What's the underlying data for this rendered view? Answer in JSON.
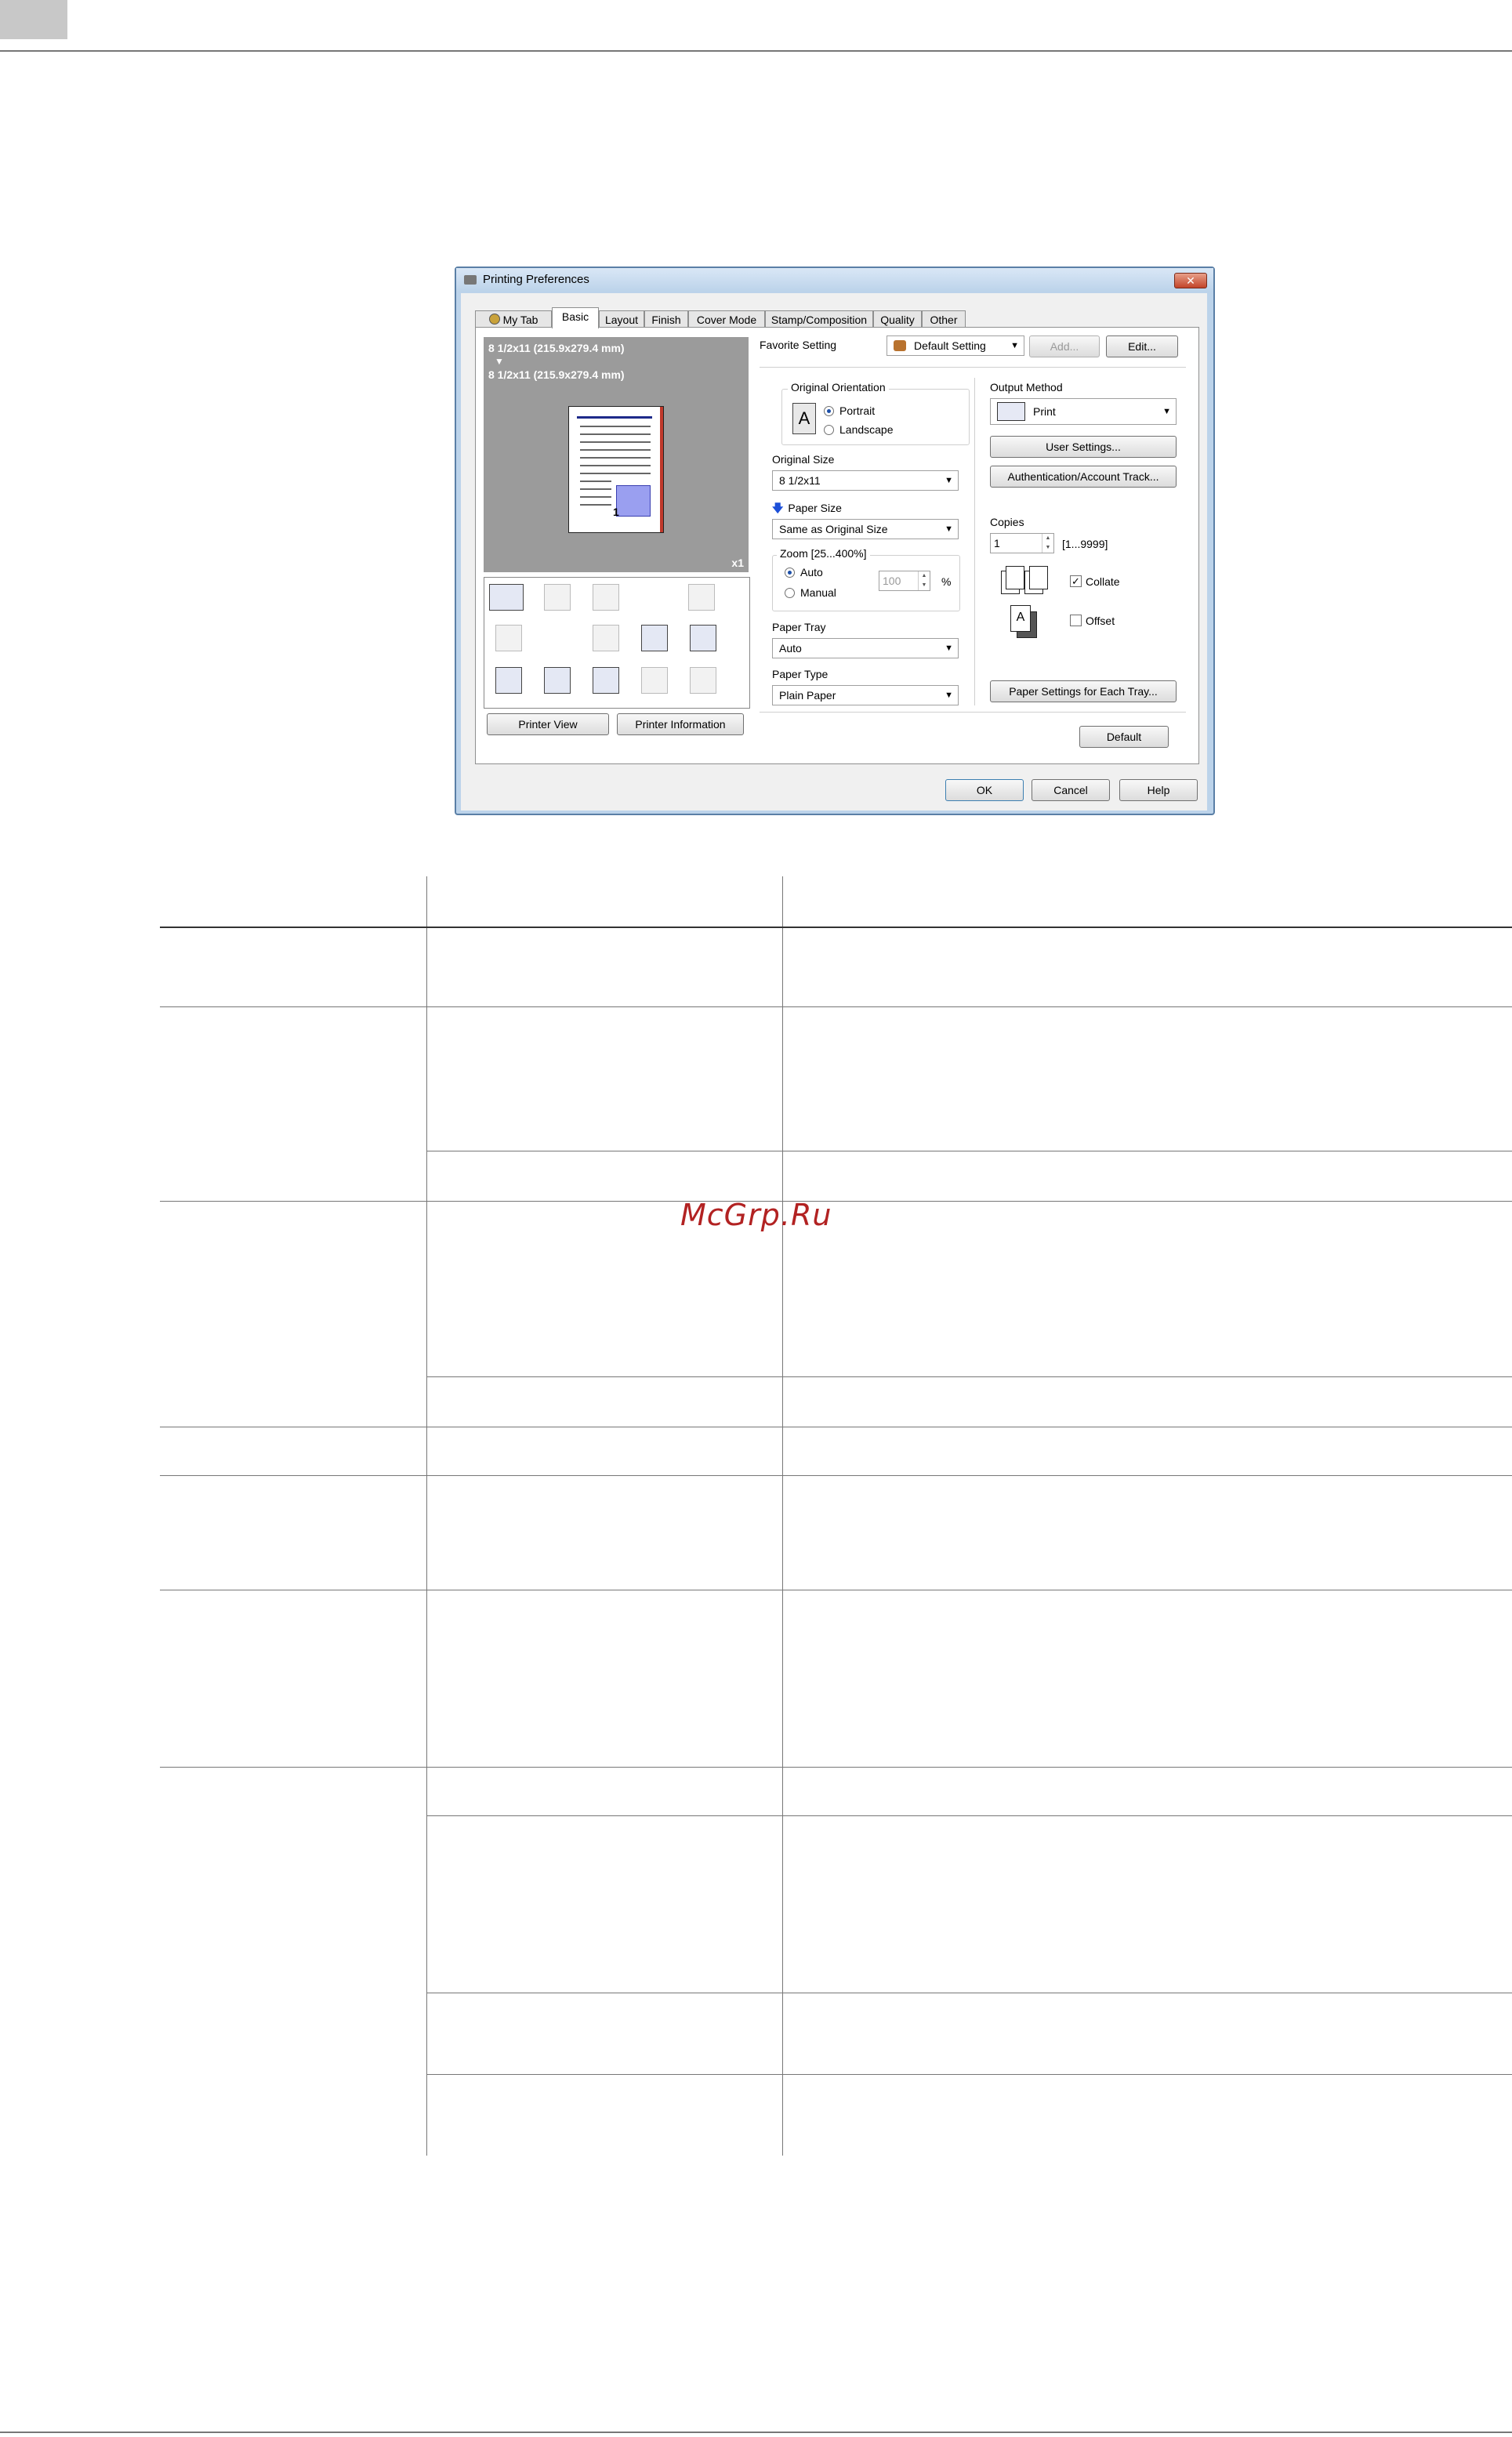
{
  "watermark": "McGrp.Ru",
  "dialog": {
    "title": "Printing Preferences",
    "close_symbol": "✕",
    "tabs": [
      "My Tab",
      "Basic",
      "Layout",
      "Finish",
      "Cover Mode",
      "Stamp/Composition",
      "Quality",
      "Other"
    ],
    "active_tab": "Basic",
    "preview": {
      "original_size_text": "8 1/2x11 (215.9x279.4 mm)",
      "arrow": "▼",
      "paper_size_text": "8 1/2x11 (215.9x279.4 mm)",
      "count": "x1",
      "page_number": "1"
    },
    "printer_view_button": "Printer View",
    "printer_information_button": "Printer Information",
    "favorite_setting": {
      "label": "Favorite Setting",
      "value": "Default Setting",
      "add_button": "Add...",
      "edit_button": "Edit..."
    },
    "original_orientation": {
      "label": "Original Orientation",
      "options": [
        "Portrait",
        "Landscape"
      ],
      "selected": "Portrait"
    },
    "original_size": {
      "label": "Original Size",
      "value": "8 1/2x11"
    },
    "paper_size": {
      "label": "Paper Size",
      "value": "Same as Original Size"
    },
    "zoom": {
      "label": "Zoom [25...400%]",
      "options": [
        "Auto",
        "Manual"
      ],
      "selected": "Auto",
      "value": "100",
      "unit": "%"
    },
    "paper_tray": {
      "label": "Paper Tray",
      "value": "Auto"
    },
    "paper_type": {
      "label": "Paper Type",
      "value": "Plain Paper"
    },
    "output_method": {
      "label": "Output Method",
      "value": "Print"
    },
    "user_settings_button": "User Settings...",
    "authentication_button": "Authentication/Account Track...",
    "copies": {
      "label": "Copies",
      "value": "1",
      "range": "[1...9999]"
    },
    "collate": {
      "label": "Collate",
      "checked": true
    },
    "offset": {
      "label": "Offset",
      "checked": false
    },
    "paper_settings_button": "Paper Settings for Each Tray...",
    "default_button": "Default",
    "ok_button": "OK",
    "cancel_button": "Cancel",
    "help_button": "Help"
  },
  "colors": {
    "dialog_frame": "#bcd3ea",
    "radio_dot": "#1c4fa8",
    "close_button": "#c2442a",
    "watermark": "#b22222"
  }
}
